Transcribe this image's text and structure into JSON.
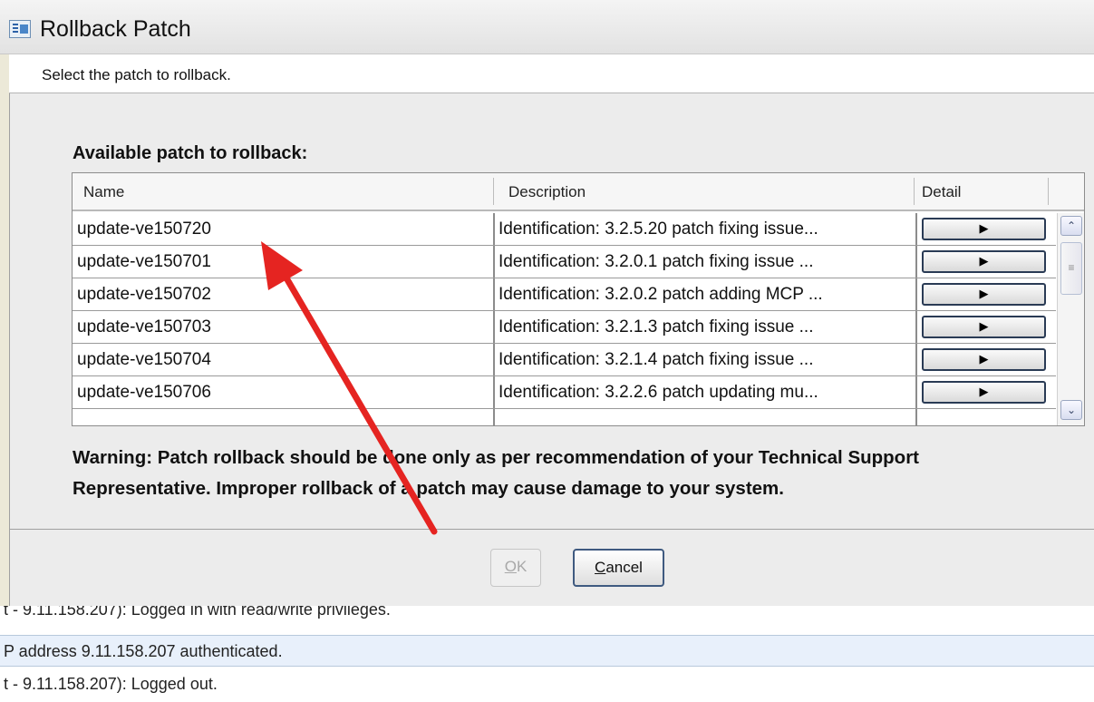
{
  "window": {
    "title": "Rollback Patch",
    "icon": "window-app-icon"
  },
  "instruction": "Select the patch to rollback.",
  "table": {
    "label": "Available patch to rollback:",
    "columns": [
      "Name",
      "Description",
      "Detail"
    ],
    "detail_icon": "play-triangle-icon",
    "detail_glyph": "▶",
    "rows": [
      {
        "name": "update-ve150720",
        "description": "Identification: 3.2.5.20 patch fixing issue..."
      },
      {
        "name": "update-ve150701",
        "description": "Identification: 3.2.0.1 patch fixing issue ..."
      },
      {
        "name": "update-ve150702",
        "description": "Identification: 3.2.0.2 patch adding MCP ..."
      },
      {
        "name": "update-ve150703",
        "description": "Identification: 3.2.1.3 patch fixing issue ..."
      },
      {
        "name": "update-ve150704",
        "description": "Identification: 3.2.1.4 patch fixing issue ..."
      },
      {
        "name": "update-ve150706",
        "description": "Identification: 3.2.2.6 patch updating mu..."
      }
    ],
    "scroll_up_glyph": "⌃",
    "scroll_down_glyph": "⌄",
    "scroll_thumb_glyph": "≡"
  },
  "warning": {
    "line1": "Warning: Patch rollback should be done only as per recommendation of your Technical Support",
    "line2": "Representative. Improper rollback of a patch may cause damage to your system."
  },
  "buttons": {
    "ok": {
      "mnemonic": "O",
      "rest": "K"
    },
    "cancel": {
      "mnemonic": "C",
      "rest": "ancel"
    }
  },
  "log_lines": [
    "t - 9.11.158.207): Logged in with read/write privileges.",
    "P address 9.11.158.207 authenticated.",
    "t - 9.11.158.207): Logged out."
  ],
  "annotation": {
    "color": "#e52421"
  }
}
